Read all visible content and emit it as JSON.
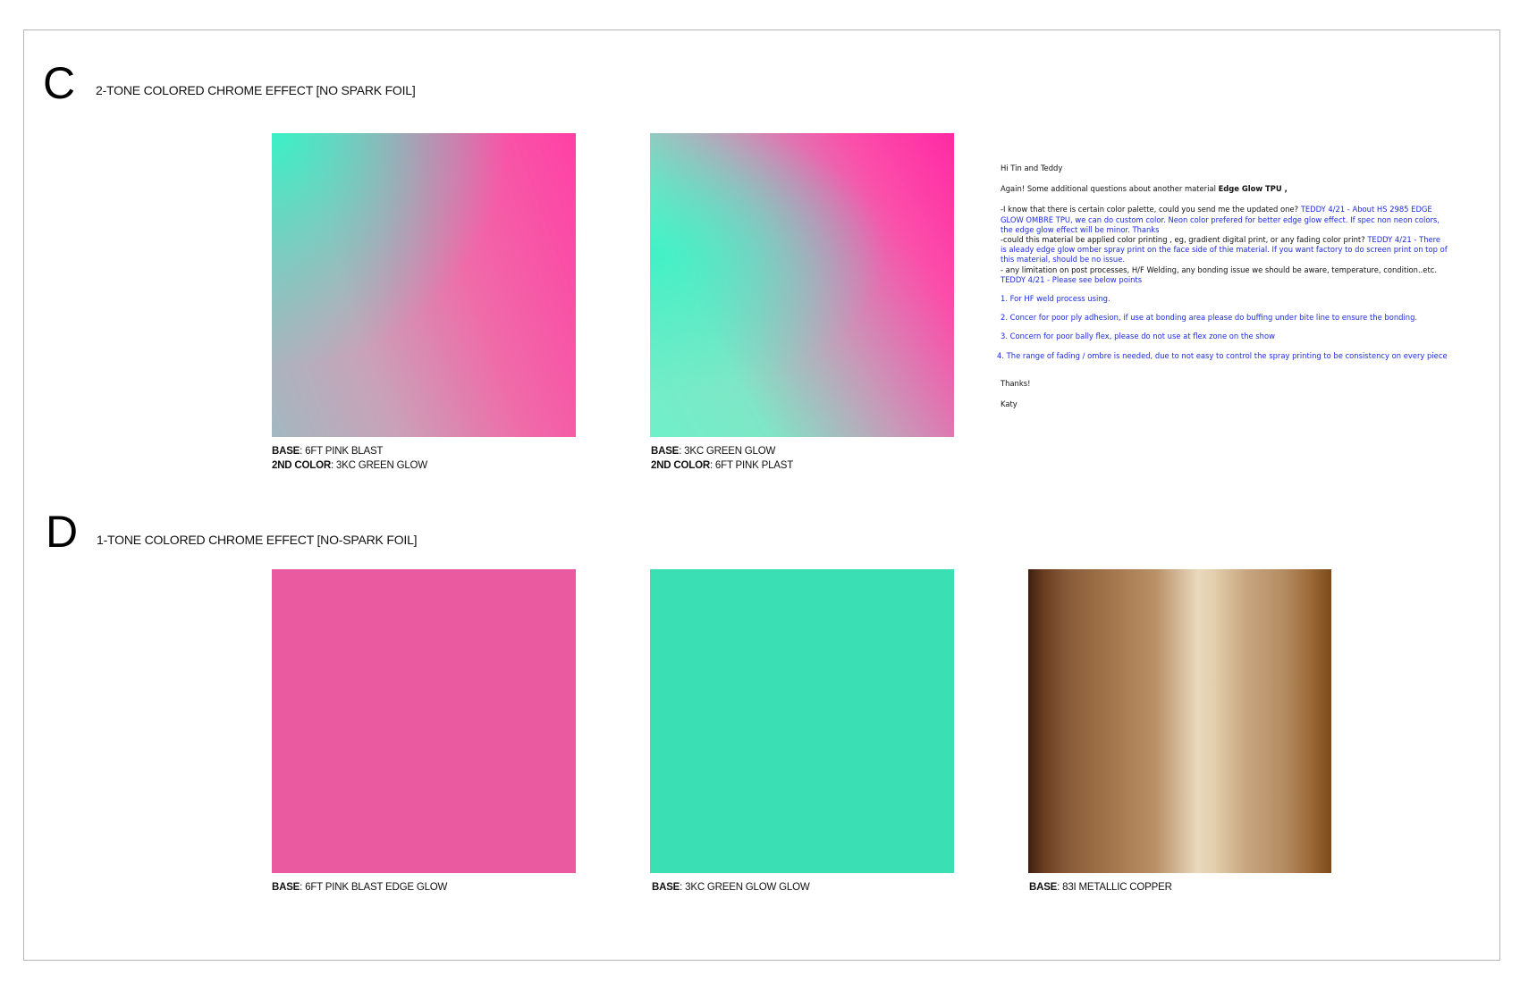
{
  "sections": [
    {
      "letter": "C",
      "title": "2-TONE COLORED CHROME EFFECT [NO SPARK FOIL]"
    },
    {
      "letter": "D",
      "title": "1-TONE COLORED CHROME EFFECT [NO-SPARK FOIL]"
    }
  ],
  "swatches": {
    "c1": {
      "base_label": "BASE",
      "base_value": ": 6FT PINK BLAST",
      "second_label": "2ND COLOR",
      "second_value": ": 3KC GREEN GLOW",
      "colors": [
        "#3af0c6",
        "#ff40a5"
      ]
    },
    "c2": {
      "base_label": "BASE",
      "base_value": ": 3KC GREEN GLOW",
      "second_label": "2ND COLOR",
      "second_value": ": 6FT PINK PLAST",
      "colors": [
        "#3cf2c6",
        "#ff2aa4"
      ]
    },
    "d1": {
      "base_label": "BASE",
      "base_value": ": 6FT PINK BLAST EDGE GLOW",
      "colors": [
        "#ea5aa0"
      ]
    },
    "d2": {
      "base_label": "BASE",
      "base_value": ": 3KC GREEN GLOW GLOW",
      "colors": [
        "#3ae0b3"
      ]
    },
    "d3": {
      "base_label": "BASE",
      "base_value": ": 83I METALLIC COPPER",
      "colors": [
        "#3e1e10",
        "#a87a4f",
        "#ead9bd",
        "#7b4a1a"
      ]
    }
  },
  "note": {
    "greeting": "Hi Tin and Teddy",
    "intro_text": "Again!  Some additional questions about another material ",
    "intro_bold": "Edge Glow TPU ,",
    "q1_text": "-I know that there is certain color palette, could you send me the updated one? ",
    "q1_reply": "TEDDY 4/21 - About HS 2985 EDGE GLOW OMBRE TPU, we can do custom color. Neon color prefered for better edge glow effect. If spec non neon colors, the edge glow effect will be minor. Thanks",
    "q2_text": "-could this material be applied color printing , eg, gradient digital print, or any fading color print?  ",
    "q2_reply": "TEDDY 4/21 - There is aleady edge glow omber spray print on the face side of thie material. If you want factory to do screen print on top of this material, should be no issue.",
    "q3_text": "- any limitation on post processes, H/F Welding, any bonding issue we should be aware, temperature, condition..etc. ",
    "q3_reply": "TEDDY 4/21 - Please see below points",
    "points": [
      "1. For HF weld process using.",
      "2. Concer for poor ply adhesion, if use at bonding area please do buffing under bite line to ensure the bonding.",
      "3. Concern for poor bally flex, please do not use at flex zone on the show",
      "4. The range of fading / ombre is needed, due to not easy to control the spray printing to be consistency on every piece"
    ],
    "thanks": "Thanks!",
    "signature": "Katy"
  }
}
